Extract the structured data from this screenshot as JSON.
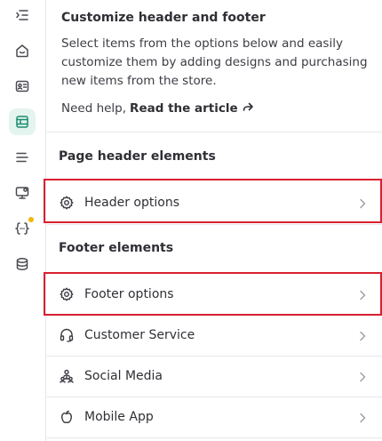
{
  "intro": {
    "title": "Customize header and footer",
    "description": "Select items from the options below and easily customize them by adding designs and purchasing new items from the store.",
    "help_prefix": "Need help,",
    "help_link": "Read the article"
  },
  "sections": {
    "header_title": "Page header elements",
    "footer_title": "Footer elements"
  },
  "rows": {
    "header_options": "Header options",
    "footer_options": "Footer options",
    "customer_service": "Customer Service",
    "social_media": "Social Media",
    "mobile_app": "Mobile App"
  },
  "colors": {
    "highlight": "#d8202f",
    "active_rail_bg": "#e4f4ef",
    "notification_dot": "#f2b705"
  },
  "rail_icons": [
    "collapse-menu-icon",
    "home-icon",
    "id-card-icon",
    "layout-icon",
    "list-icon",
    "monitor-settings-icon",
    "code-braces-icon",
    "database-icon"
  ]
}
